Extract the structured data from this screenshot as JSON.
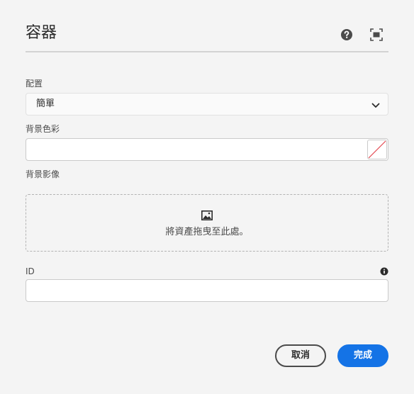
{
  "dialog": {
    "title": "容器"
  },
  "layout_field": {
    "label": "配置",
    "value": "簡單"
  },
  "bg_color": {
    "label": "背景色彩",
    "value": ""
  },
  "bg_image": {
    "label": "背景影像",
    "dropzone_text": "將資產拖曳至此處。"
  },
  "id_field": {
    "label": "ID",
    "value": ""
  },
  "buttons": {
    "cancel": "取消",
    "done": "完成"
  },
  "icons": {
    "help": "help-icon",
    "fullscreen": "fullscreen-icon",
    "chevron": "chevron-down-icon",
    "swatch": "color-swatch-none-icon",
    "image": "image-icon",
    "info": "info-icon"
  },
  "colors": {
    "accent": "#1473e6",
    "background": "#f4f4f4",
    "swatch_slash": "#e34850"
  }
}
